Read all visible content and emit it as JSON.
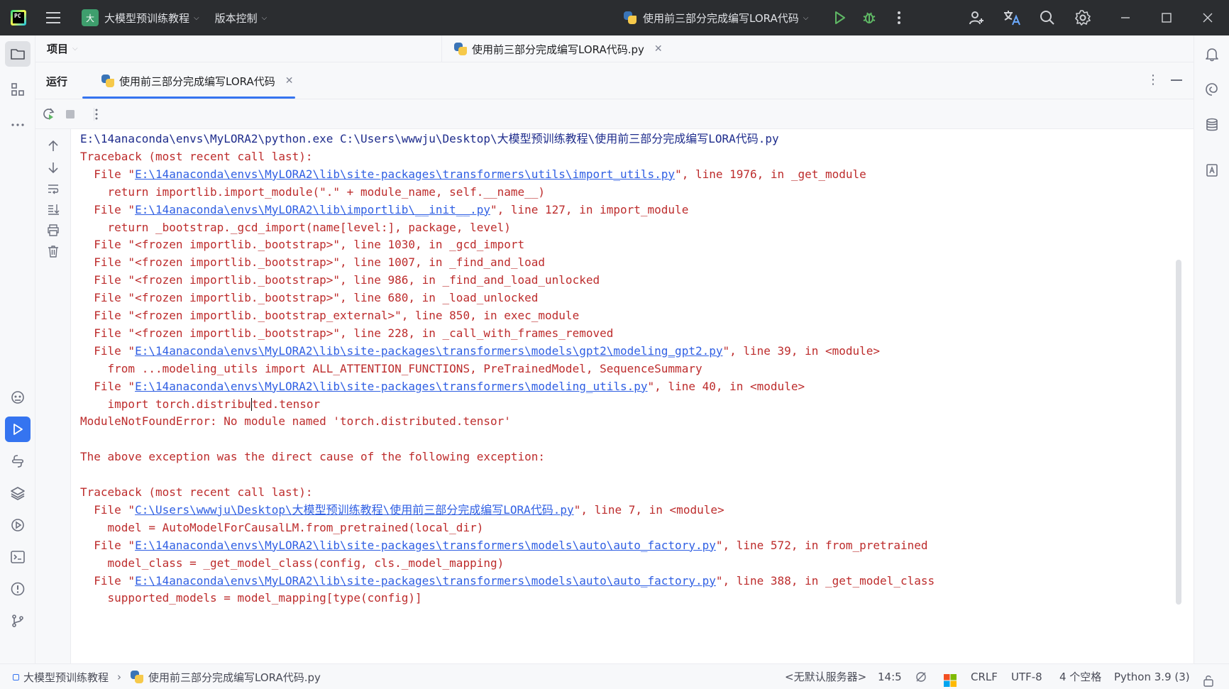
{
  "titlebar": {
    "logo_text": "PC",
    "project_badge": "大",
    "project_name": "大模型预训练教程",
    "vcs_label": "版本控制",
    "run_config": "使用前三部分完成编写LORA代码"
  },
  "project_panel": {
    "title": "项目"
  },
  "editor": {
    "tab_label": "使用前三部分完成编写LORA代码.py"
  },
  "run_panel": {
    "title": "运行",
    "tab_label": "使用前三部分完成编写LORA代码"
  },
  "console": {
    "lines": [
      {
        "type": "cmd",
        "text": "E:\\14anaconda\\envs\\MyLORA2\\python.exe C:\\Users\\wwwju\\Desktop\\大模型预训练教程\\使用前三部分完成编写LORA代码.py"
      },
      {
        "type": "text",
        "text": "Traceback (most recent call last):"
      },
      {
        "type": "file",
        "pre": "  File \"",
        "link": "E:\\14anaconda\\envs\\MyLORA2\\lib\\site-packages\\transformers\\utils\\import_utils.py",
        "post": "\", line 1976, in _get_module"
      },
      {
        "type": "text",
        "text": "    return importlib.import_module(\".\" + module_name, self.__name__)"
      },
      {
        "type": "file",
        "pre": "  File \"",
        "link": "E:\\14anaconda\\envs\\MyLORA2\\lib\\importlib\\__init__.py",
        "post": "\", line 127, in import_module"
      },
      {
        "type": "text",
        "text": "    return _bootstrap._gcd_import(name[level:], package, level)"
      },
      {
        "type": "text",
        "text": "  File \"<frozen importlib._bootstrap>\", line 1030, in _gcd_import"
      },
      {
        "type": "text",
        "text": "  File \"<frozen importlib._bootstrap>\", line 1007, in _find_and_load"
      },
      {
        "type": "text",
        "text": "  File \"<frozen importlib._bootstrap>\", line 986, in _find_and_load_unlocked"
      },
      {
        "type": "text",
        "text": "  File \"<frozen importlib._bootstrap>\", line 680, in _load_unlocked"
      },
      {
        "type": "text",
        "text": "  File \"<frozen importlib._bootstrap_external>\", line 850, in exec_module"
      },
      {
        "type": "text",
        "text": "  File \"<frozen importlib._bootstrap>\", line 228, in _call_with_frames_removed"
      },
      {
        "type": "file",
        "pre": "  File \"",
        "link": "E:\\14anaconda\\envs\\MyLORA2\\lib\\site-packages\\transformers\\models\\gpt2\\modeling_gpt2.py",
        "post": "\", line 39, in <module>"
      },
      {
        "type": "text",
        "text": "    from ...modeling_utils import ALL_ATTENTION_FUNCTIONS, PreTrainedModel, SequenceSummary"
      },
      {
        "type": "file",
        "pre": "  File \"",
        "link": "E:\\14anaconda\\envs\\MyLORA2\\lib\\site-packages\\transformers\\modeling_utils.py",
        "post": "\", line 40, in <module>"
      },
      {
        "type": "caret",
        "pre": "    import torch.distribu",
        "post": "ted.tensor"
      },
      {
        "type": "text",
        "text": "ModuleNotFoundError: No module named 'torch.distributed.tensor'"
      },
      {
        "type": "text",
        "text": ""
      },
      {
        "type": "text",
        "text": "The above exception was the direct cause of the following exception:"
      },
      {
        "type": "text",
        "text": ""
      },
      {
        "type": "text",
        "text": "Traceback (most recent call last):"
      },
      {
        "type": "file",
        "pre": "  File \"",
        "link": "C:\\Users\\wwwju\\Desktop\\大模型预训练教程\\使用前三部分完成编写LORA代码.py",
        "post": "\", line 7, in <module>"
      },
      {
        "type": "text",
        "text": "    model = AutoModelForCausalLM.from_pretrained(local_dir)"
      },
      {
        "type": "file",
        "pre": "  File \"",
        "link": "E:\\14anaconda\\envs\\MyLORA2\\lib\\site-packages\\transformers\\models\\auto\\auto_factory.py",
        "post": "\", line 572, in from_pretrained"
      },
      {
        "type": "text",
        "text": "    model_class = _get_model_class(config, cls._model_mapping)"
      },
      {
        "type": "file",
        "pre": "  File \"",
        "link": "E:\\14anaconda\\envs\\MyLORA2\\lib\\site-packages\\transformers\\models\\auto\\auto_factory.py",
        "post": "\", line 388, in _get_model_class"
      },
      {
        "type": "text",
        "text": "    supported_models = model_mapping[type(config)]"
      }
    ]
  },
  "statusbar": {
    "breadcrumb_project": "大模型预训练教程",
    "breadcrumb_file": "使用前三部分完成编写LORA代码.py",
    "server": "<无默认服务器>",
    "position": "14:5",
    "line_sep": "CRLF",
    "encoding": "UTF-8",
    "indent": "4 个空格",
    "interpreter": "Python 3.9 (3)"
  },
  "colors": {
    "titlebar_bg": "#2b2d30",
    "accent": "#3574f0",
    "error_text": "#bd2c2c",
    "link": "#2f5fe3",
    "cmd_text": "#1e2c8c"
  }
}
